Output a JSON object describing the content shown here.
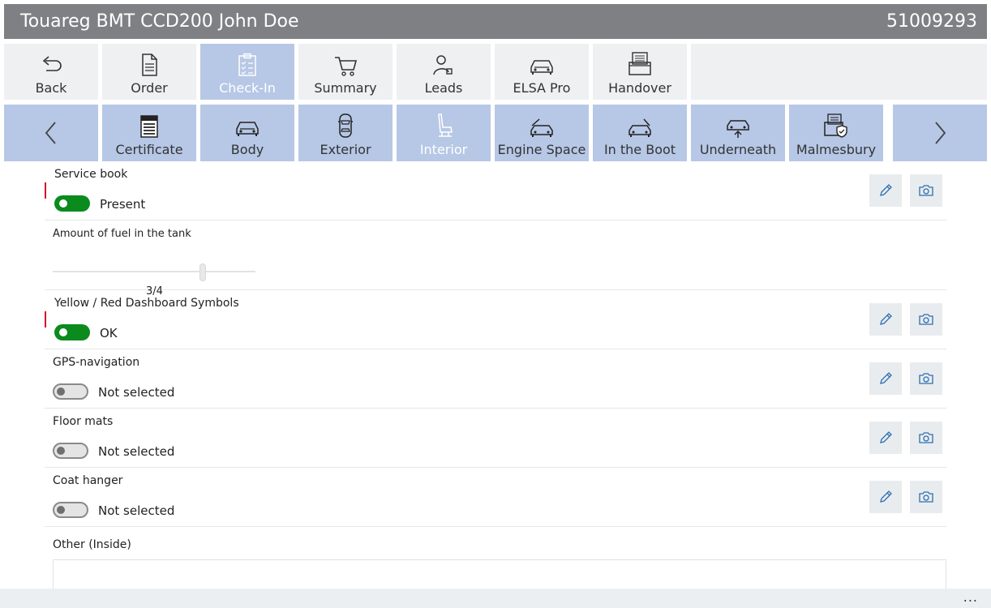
{
  "header": {
    "title": "Touareg BMT CCD200 John Doe",
    "number": "51009293"
  },
  "main_tabs": [
    {
      "label": "Back",
      "icon": "back-arrow-icon"
    },
    {
      "label": "Order",
      "icon": "document-icon"
    },
    {
      "label": "Check-In",
      "icon": "clipboard-checklist-icon",
      "active": true
    },
    {
      "label": "Summary",
      "icon": "cart-icon"
    },
    {
      "label": "Leads",
      "icon": "person-icon"
    },
    {
      "label": "ELSA Pro",
      "icon": "car-front-icon"
    },
    {
      "label": "Handover",
      "icon": "documents-stack-icon"
    }
  ],
  "sub_tabs": [
    {
      "label": "Certificate",
      "icon": "certificate-icon"
    },
    {
      "label": "Body",
      "icon": "car-body-icon"
    },
    {
      "label": "Exterior",
      "icon": "car-top-view-icon"
    },
    {
      "label": "Interior",
      "icon": "seat-icon",
      "active": true
    },
    {
      "label": "Engine Space",
      "icon": "car-hood-open-icon"
    },
    {
      "label": "In the Boot",
      "icon": "car-boot-open-icon"
    },
    {
      "label": "Underneath",
      "icon": "car-lift-icon"
    },
    {
      "label": "Malmesbury",
      "icon": "folder-shield-icon"
    }
  ],
  "items": {
    "service_book": {
      "label": "Service book",
      "state": "Present"
    },
    "fuel": {
      "label": "Amount of fuel in the tank",
      "value": "3/4",
      "level": 0.75
    },
    "dashboard": {
      "label": "Yellow / Red Dashboard Symbols",
      "state": "OK"
    },
    "gps": {
      "label": "GPS-navigation",
      "state": "Not selected"
    },
    "floor_mats": {
      "label": "Floor mats",
      "state": "Not selected"
    },
    "coat_hanger": {
      "label": "Coat hanger",
      "state": "Not selected"
    },
    "other": {
      "label": "Other (Inside)",
      "value": ""
    }
  },
  "footer": {
    "more": "..."
  },
  "colors": {
    "accent": "#b7c7e6",
    "toggle_on": "#0b8a1d",
    "required": "#d0112b",
    "titlebar": "#7f8083"
  }
}
